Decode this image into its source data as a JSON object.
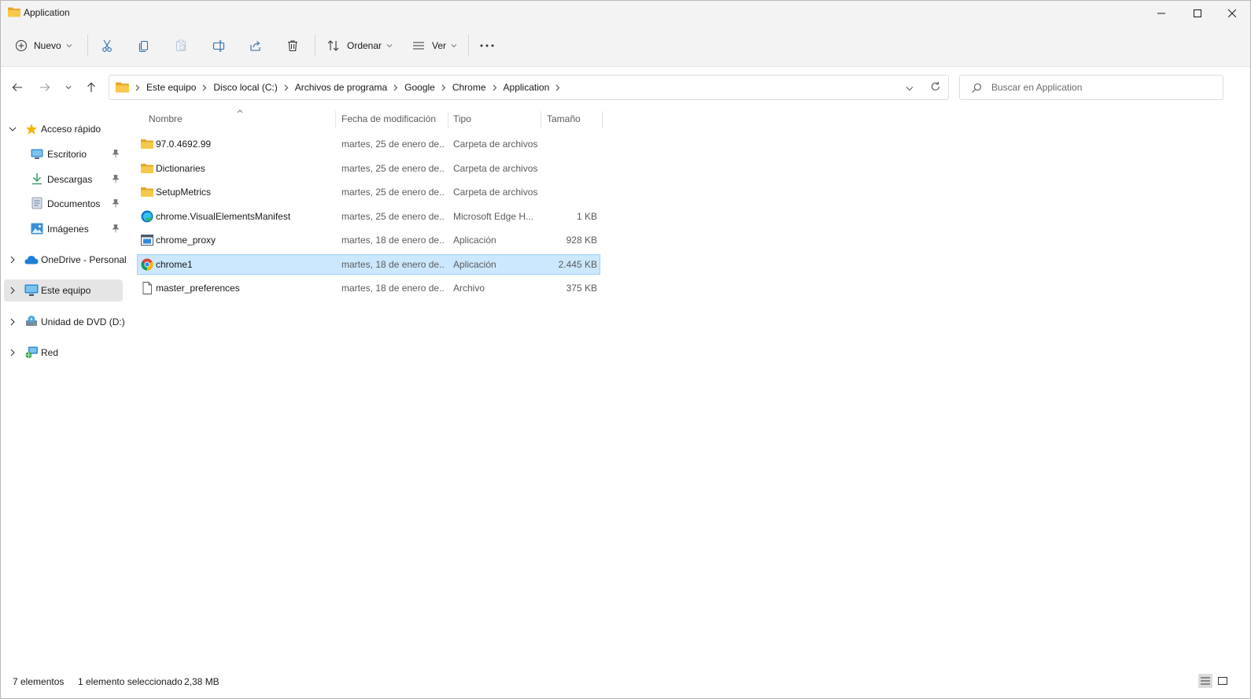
{
  "window": {
    "title": "Application"
  },
  "toolbar": {
    "new_label": "Nuevo",
    "sort_label": "Ordenar",
    "view_label": "Ver"
  },
  "breadcrumb": [
    "Este equipo",
    "Disco local (C:)",
    "Archivos de programa",
    "Google",
    "Chrome",
    "Application"
  ],
  "search": {
    "placeholder": "Buscar en Application"
  },
  "sidebar": {
    "quick_access": "Acceso rápido",
    "pinned": [
      {
        "label": "Escritorio",
        "icon": "desktop-icon"
      },
      {
        "label": "Descargas",
        "icon": "download-icon"
      },
      {
        "label": "Documentos",
        "icon": "documents-icon"
      },
      {
        "label": "Imágenes",
        "icon": "pictures-icon"
      }
    ],
    "onedrive": "OneDrive - Personal",
    "this_pc": "Este equipo",
    "dvd": "Unidad de DVD (D:)",
    "network": "Red"
  },
  "columns": {
    "name": "Nombre",
    "date": "Fecha de modificación",
    "type": "Tipo",
    "size": "Tamaño"
  },
  "files": [
    {
      "name": "97.0.4692.99",
      "date": "martes, 25 de enero de...",
      "type": "Carpeta de archivos",
      "size": "",
      "icon": "folder-icon"
    },
    {
      "name": "Dictionaries",
      "date": "martes, 25 de enero de...",
      "type": "Carpeta de archivos",
      "size": "",
      "icon": "folder-icon"
    },
    {
      "name": "SetupMetrics",
      "date": "martes, 25 de enero de...",
      "type": "Carpeta de archivos",
      "size": "",
      "icon": "folder-icon"
    },
    {
      "name": "chrome.VisualElementsManifest",
      "date": "martes, 25 de enero de...",
      "type": "Microsoft Edge H...",
      "size": "1 KB",
      "icon": "edge-icon"
    },
    {
      "name": "chrome_proxy",
      "date": "martes, 18 de enero de...",
      "type": "Aplicación",
      "size": "928 KB",
      "icon": "application-icon"
    },
    {
      "name": "chrome1",
      "date": "martes, 18 de enero de...",
      "type": "Aplicación",
      "size": "2.445 KB",
      "icon": "chrome-icon"
    },
    {
      "name": "master_preferences",
      "date": "martes, 18 de enero de...",
      "type": "Archivo",
      "size": "375 KB",
      "icon": "file-icon"
    }
  ],
  "status": {
    "count": "7 elementos",
    "selected": "1 elemento seleccionado",
    "selected_size": "2,38 MB"
  },
  "colors": {
    "selection_bg": "#cce8ff",
    "selection_border": "#99d1ff",
    "folder": "#f8c84a",
    "chrome_bg": "#f3f3f3"
  }
}
